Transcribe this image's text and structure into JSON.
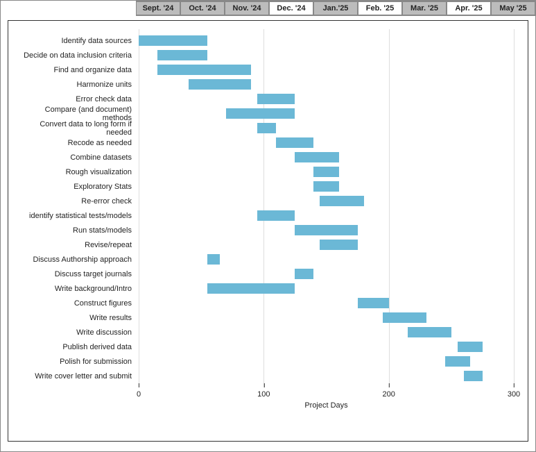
{
  "timeline_months": [
    {
      "label": "Sept. '24",
      "shaded": true
    },
    {
      "label": "Oct. '24",
      "shaded": true
    },
    {
      "label": "Nov. '24",
      "shaded": true
    },
    {
      "label": "Dec. '24",
      "shaded": false
    },
    {
      "label": "Jan.'25",
      "shaded": true
    },
    {
      "label": "Feb. '25",
      "shaded": false
    },
    {
      "label": "Mar. '25",
      "shaded": true
    },
    {
      "label": "Apr. '25",
      "shaded": false
    },
    {
      "label": "May '25",
      "shaded": true
    }
  ],
  "chart_data": {
    "type": "bar",
    "orientation": "horizontal-gantt",
    "xlabel": "Project Days",
    "ylabel": "",
    "xlim": [
      0,
      300
    ],
    "x_ticks": [
      0,
      100,
      200,
      300
    ],
    "tasks": [
      {
        "name": "Identify data sources",
        "start": 0,
        "end": 55
      },
      {
        "name": "Decide on data inclusion criteria",
        "start": 15,
        "end": 55
      },
      {
        "name": "Find and organize data",
        "start": 15,
        "end": 90
      },
      {
        "name": "Harmonize units",
        "start": 40,
        "end": 90
      },
      {
        "name": "Error check data",
        "start": 95,
        "end": 125
      },
      {
        "name": "Compare (and document) methods",
        "start": 70,
        "end": 125
      },
      {
        "name": "Convert data to long form if needed",
        "start": 95,
        "end": 110
      },
      {
        "name": "Recode as needed",
        "start": 110,
        "end": 140
      },
      {
        "name": "Combine datasets",
        "start": 125,
        "end": 160
      },
      {
        "name": "Rough visualization",
        "start": 140,
        "end": 160
      },
      {
        "name": "Exploratory Stats",
        "start": 140,
        "end": 160
      },
      {
        "name": "Re-error check",
        "start": 145,
        "end": 180
      },
      {
        "name": "identify statistical tests/models",
        "start": 95,
        "end": 125
      },
      {
        "name": "Run stats/models",
        "start": 125,
        "end": 175
      },
      {
        "name": "Revise/repeat",
        "start": 145,
        "end": 175
      },
      {
        "name": "Discuss Authorship approach",
        "start": 55,
        "end": 65
      },
      {
        "name": "Discuss target journals",
        "start": 125,
        "end": 140
      },
      {
        "name": "Write background/Intro",
        "start": 55,
        "end": 125
      },
      {
        "name": "Construct figures",
        "start": 175,
        "end": 200
      },
      {
        "name": "Write results",
        "start": 195,
        "end": 230
      },
      {
        "name": "Write discussion",
        "start": 215,
        "end": 250
      },
      {
        "name": "Publish derived data",
        "start": 255,
        "end": 275
      },
      {
        "name": "Polish for submission",
        "start": 245,
        "end": 265
      },
      {
        "name": "Write cover letter and submit",
        "start": 260,
        "end": 275
      }
    ]
  }
}
